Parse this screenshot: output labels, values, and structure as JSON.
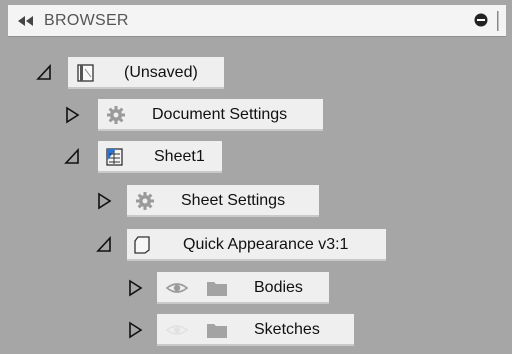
{
  "panel": {
    "title": "BROWSER",
    "collapse_icon": "double-chevron-left-icon",
    "minimize_icon": "minus-circle-icon",
    "grip_icon": "vertical-grip-icon"
  },
  "tree": {
    "root_label": "(Unsaved)",
    "document_settings_label": "Document Settings",
    "sheet_label": "Sheet1",
    "sheet_settings_label": "Sheet Settings",
    "component_label": "Quick Appearance v3:1",
    "bodies_label": "Bodies",
    "sketches_label": "Sketches"
  },
  "colors": {
    "panel_background": "#a6a6a6",
    "node_background": "#efefef",
    "accent_blue": "#2d73d6"
  }
}
